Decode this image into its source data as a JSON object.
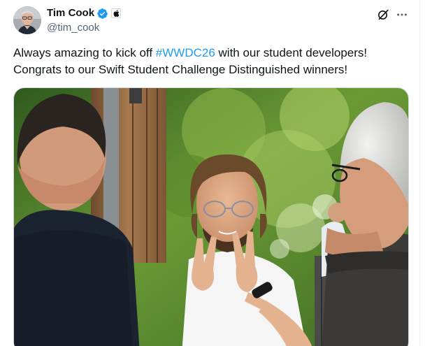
{
  "post": {
    "author": {
      "display_name": "Tim Cook",
      "handle": "@tim_cook",
      "verified": true,
      "affiliate_badge": "apple-logo-icon"
    },
    "text": {
      "line1_prefix": "Always amazing to kick off ",
      "hashtag": "#WWDC26",
      "line1_suffix": " with our student developers!",
      "line2": "Congrats to our Swift Student Challenge Distinguished winners!"
    },
    "actions": {
      "grok_icon": "grok-slash-icon",
      "more_icon": "more-options-icon"
    },
    "media": {
      "type": "photo"
    }
  },
  "colors": {
    "text_primary": "#0f1419",
    "text_secondary": "#536471",
    "link": "#1d9bf0",
    "verified_badge": "#1d9bf0",
    "border": "#cfd9de"
  }
}
